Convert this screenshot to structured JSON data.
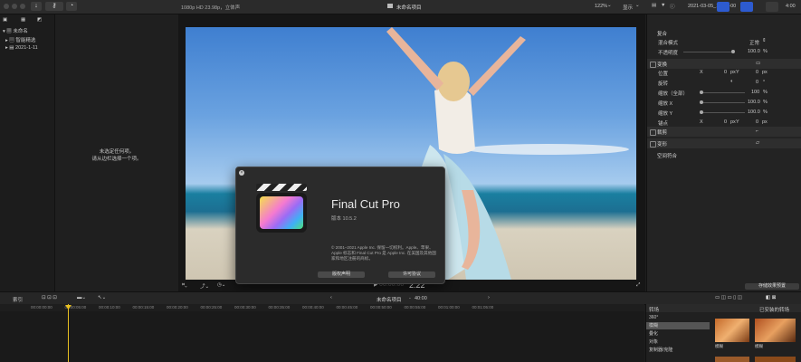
{
  "toolbar": {
    "format_info": "1080p HD 23.98p，立体声",
    "project_title": "未命名项目",
    "zoom": "122%",
    "view_label": "显示",
    "date": "2021-03-05_14-23-00",
    "duration": "4:00"
  },
  "library": {
    "items": [
      {
        "label": "未命名"
      },
      {
        "label": "智能精选"
      },
      {
        "label": "2021-1-11"
      }
    ]
  },
  "browser": {
    "empty_line1": "未选定任何项。",
    "empty_line2": "请从边栏选择一个项。"
  },
  "dialog": {
    "app_name": "Final Cut Pro",
    "version": "版本 10.5.2",
    "copyright_1": "© 2001–2021 Apple Inc. 保留一切权利。Apple、苹果、",
    "copyright_2": "Apple 标志和 Final Cut Pro 是 Apple Inc. 在美国及其他国",
    "copyright_3": "家和地区注册的商标。",
    "btn_license": "版权声明",
    "btn_agreement": "许可协议"
  },
  "viewer": {
    "timecode": "00:00:00",
    "timecode_frame": "2:22"
  },
  "inspector": {
    "compositing": "复合",
    "blend_mode_label": "混合模式",
    "blend_mode_value": "正常",
    "opacity_label": "不透明度",
    "opacity_value": "100.0",
    "opacity_unit": "%",
    "transform": "变换",
    "position_label": "位置",
    "x_label": "X",
    "x_value": "0",
    "px": "px",
    "y_label": "Y",
    "y_value": "0",
    "rotation_label": "旋转",
    "rotation_value": "0",
    "deg": "°",
    "scale_all_label": "缩放（全部）",
    "scale_all_value": "100",
    "scale_x_label": "缩放 X",
    "scale_x_value": "100.0",
    "scale_y_label": "缩放 Y",
    "scale_y_value": "100.0",
    "anchor_label": "锚点",
    "anchor_x": "0",
    "anchor_y": "0",
    "crop": "裁剪",
    "distort": "变形",
    "spatial_conform": "空间符合",
    "save_preset": "存储效果预置"
  },
  "timeline": {
    "index_label": "索引",
    "project_name": "未命名项目",
    "duration": "40:00",
    "ruler_ticks": [
      "00:00:00:00",
      "00:00:05:00",
      "00:00:10:00",
      "00:00:15:00",
      "00:00:20:00",
      "00:00:25:00",
      "00:00:30:00",
      "00:00:35:00",
      "00:00:40:00",
      "00:00:45:00",
      "00:00:50:00",
      "00:00:55:00",
      "00:01:00:00",
      "00:01:05:00"
    ]
  },
  "transitions": {
    "title": "转场",
    "installed": "已安装的转场",
    "categories": [
      "360°",
      "模糊",
      "叠化",
      "对象",
      "复制器/克隆"
    ],
    "thumb_labels": [
      "模糊",
      "模糊"
    ]
  }
}
